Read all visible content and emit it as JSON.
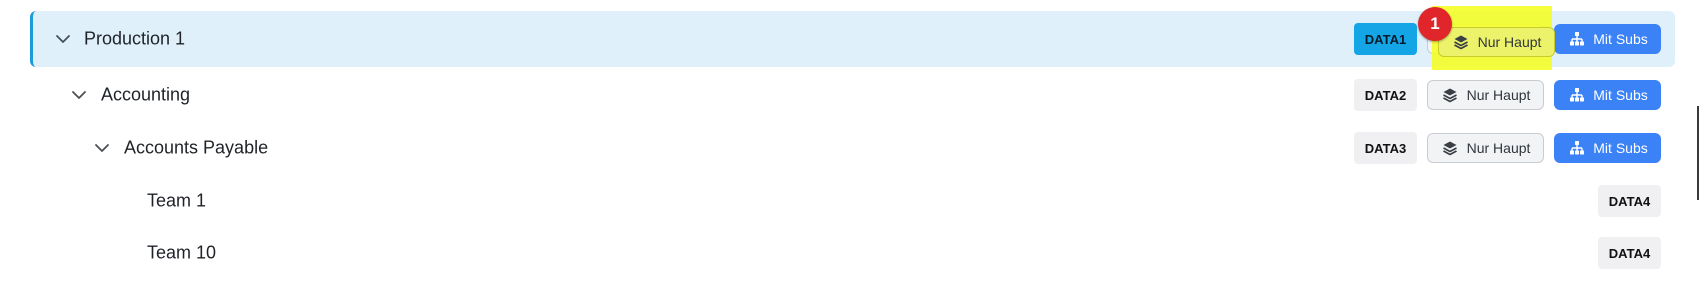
{
  "colors": {
    "selected_row_bg": "#dff0fb",
    "selected_row_accent": "#1b9bd7",
    "data_badge_primary": "#14a5e6",
    "mit_subs_bg": "#3b82f6",
    "highlight": "#f4ff1a",
    "marker": "#e0262a"
  },
  "buttons": {
    "nur_haupt_label": "Nur Haupt",
    "mit_subs_label": "Mit Subs",
    "nur_haupt_icon": "layers-icon",
    "mit_subs_icon": "hierarchy-icon"
  },
  "annotation": {
    "marker_label": "1"
  },
  "tree": {
    "rows": [
      {
        "label": "Production 1",
        "badge": "DATA1",
        "selected": true,
        "expanded": true
      },
      {
        "label": "Accounting",
        "badge": "DATA2",
        "expanded": true
      },
      {
        "label": "Accounts Payable",
        "badge": "DATA3",
        "expanded": true
      },
      {
        "label": "Team 1",
        "badge": "DATA4"
      },
      {
        "label": "Team 10",
        "badge": "DATA4"
      }
    ]
  }
}
